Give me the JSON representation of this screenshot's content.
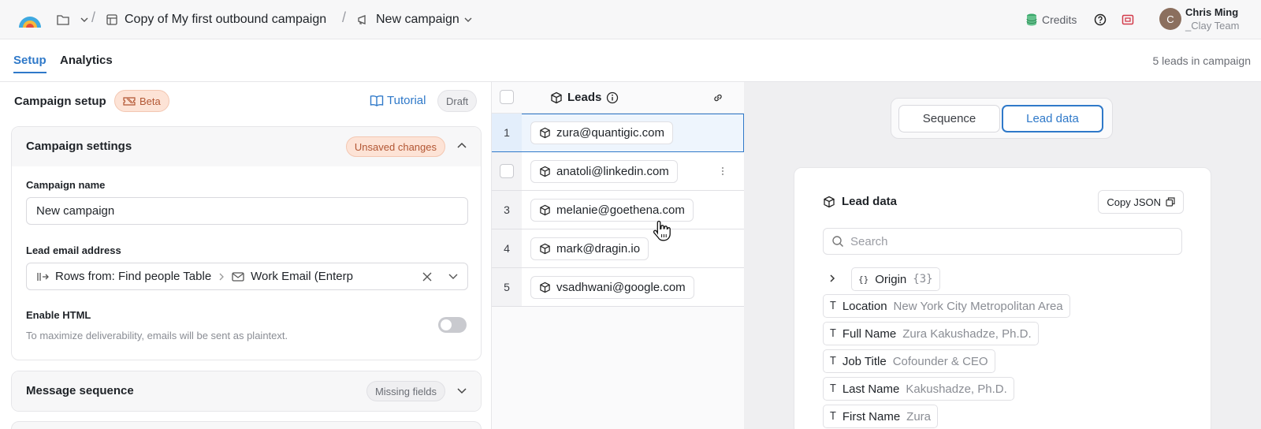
{
  "topbar": {
    "breadcrumb": [
      {
        "label": "Copy of My first outbound campaign",
        "icon": "table-icon"
      },
      {
        "label": "New campaign",
        "icon": "campaign-icon"
      }
    ],
    "credits_label": "Credits",
    "user": {
      "initial": "C",
      "name": "Chris Ming",
      "team": "_Clay Team"
    }
  },
  "tabs": {
    "items": [
      {
        "label": "Setup",
        "active": true
      },
      {
        "label": "Analytics",
        "active": false
      }
    ],
    "lead_count": "5 leads in campaign"
  },
  "setup": {
    "title": "Campaign setup",
    "beta_label": "Beta",
    "tutorial_label": "Tutorial",
    "draft_label": "Draft",
    "settings": {
      "title": "Campaign settings",
      "badge": "Unsaved changes",
      "name_label": "Campaign name",
      "name_value": "New campaign",
      "email_label": "Lead email address",
      "email_source": "Rows from: Find people Table",
      "email_field": "Work Email (Enterp",
      "html_label": "Enable HTML",
      "html_help": "To maximize deliverability, emails will be sent as plaintext.",
      "html_enabled": false
    },
    "sequence": {
      "title": "Message sequence",
      "badge": "Missing fields"
    }
  },
  "leads": {
    "title": "Leads",
    "rows": [
      {
        "index": "1",
        "email": "zura@quantigic.com"
      },
      {
        "index": "",
        "email": "anatoli@linkedin.com"
      },
      {
        "index": "3",
        "email": "melanie@goethena.com"
      },
      {
        "index": "4",
        "email": "mark@dragin.io"
      },
      {
        "index": "5",
        "email": "vsadhwani@google.com"
      }
    ]
  },
  "lead_data": {
    "segment": {
      "sequence": "Sequence",
      "lead_data": "Lead data"
    },
    "title": "Lead data",
    "copy_label": "Copy JSON",
    "search_placeholder": "Search",
    "origin": {
      "label": "Origin",
      "count": "{3}"
    },
    "fields": [
      {
        "key": "Location",
        "value": "New York City Metropolitan Area"
      },
      {
        "key": "Full Name",
        "value": "Zura Kakushadze, Ph.D."
      },
      {
        "key": "Job Title",
        "value": "Cofounder & CEO"
      },
      {
        "key": "Last Name",
        "value": "Kakushadze, Ph.D."
      },
      {
        "key": "First Name",
        "value": "Zura"
      }
    ]
  },
  "colors": {
    "accent": "#2f79c9",
    "warning_bg": "#fde3d6",
    "warning_text": "#b25633"
  }
}
